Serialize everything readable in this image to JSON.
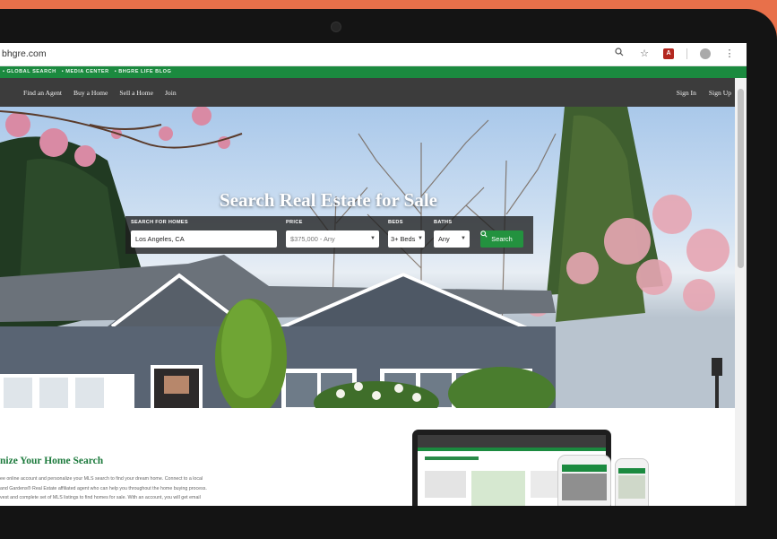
{
  "browser": {
    "url": "bhgre.com",
    "icons": [
      "zoom-icon",
      "star-icon",
      "pdf-icon",
      "profile-icon",
      "menu-icon"
    ]
  },
  "top_links": [
    "• GLOBAL SEARCH",
    "• MEDIA CENTER",
    "• BHGRE LIFE BLOG"
  ],
  "nav": {
    "left": [
      "Find an Agent",
      "Buy a Home",
      "Sell a Home",
      "Join"
    ],
    "sign_in": "Sign In",
    "sign_up": "Sign Up"
  },
  "hero": {
    "title": "Search Real Estate for Sale",
    "search": {
      "homes_label": "SEARCH FOR HOMES",
      "homes_value": "Los Angeles, CA",
      "price_label": "PRICE",
      "price_value": "$375,000  -  Any",
      "beds_label": "BEDS",
      "beds_value": "3+ Beds",
      "baths_label": "BATHS",
      "baths_value": "Any",
      "button": "Search"
    }
  },
  "personalize": {
    "title": "nize Your Home Search",
    "lines": [
      "ee online account and personalize your MLS search to find your dream home. Connect to a local",
      "and Gardens® Real Estate affiliated agent who can help you throughout the home buying process.",
      "vest and complete set of MLS listings to find homes for sale. With an account, you will get email"
    ]
  },
  "colors": {
    "brand_green": "#1b8a3f",
    "nav_dark": "#3c3c3c",
    "button_green": "#23923f",
    "orange": "#e8704a"
  }
}
